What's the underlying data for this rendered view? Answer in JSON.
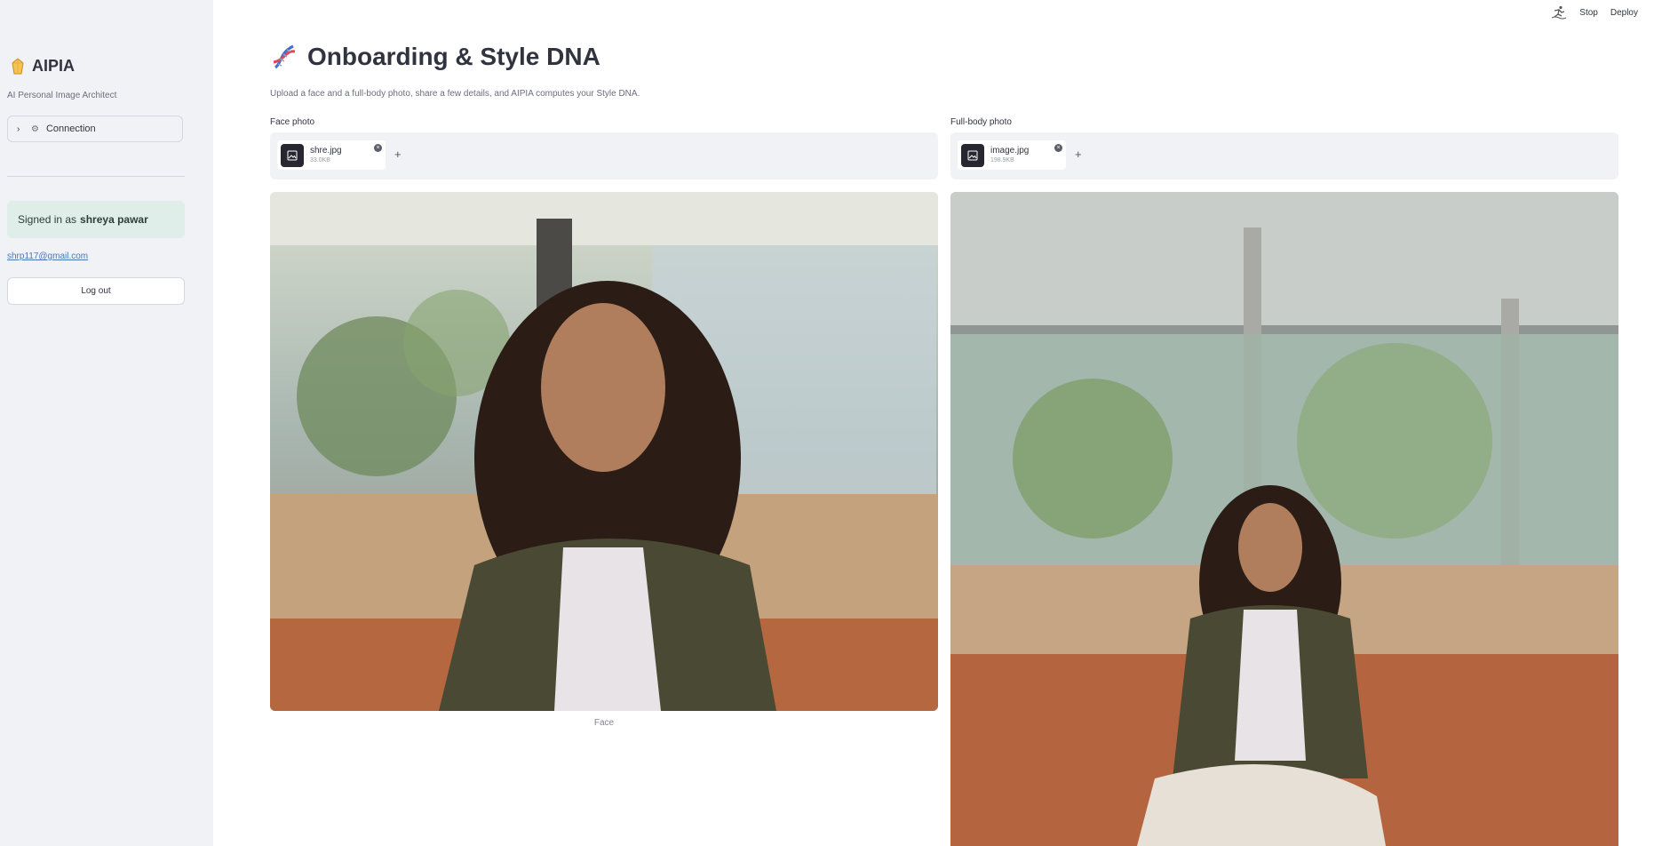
{
  "sidebar": {
    "brand_name": "AIPIA",
    "brand_sub": "AI Personal Image Architect",
    "connection_label": "Connection",
    "signed_prefix": "Signed in as",
    "signed_user": "shreya pawar",
    "email": "shrp117@gmail.com",
    "logout_label": "Log out"
  },
  "topbar": {
    "stop_label": "Stop",
    "deploy_label": "Deploy"
  },
  "main": {
    "title": "Onboarding & Style DNA",
    "subtitle": "Upload a face and a full-body photo, share a few details, and AIPIA computes your Style DNA.",
    "face": {
      "label": "Face photo",
      "file_name": "shre.jpg",
      "file_size": "33.0KB",
      "caption": "Face"
    },
    "body": {
      "label": "Full-body photo",
      "file_name": "image.jpg",
      "file_size": "198.9KB"
    }
  },
  "icons": {
    "brand": "gem-icon",
    "title": "dna-icon",
    "expander": "chevron-right-icon",
    "connection": "gear-icon",
    "run": "running-icon"
  },
  "colors": {
    "sidebar_bg": "#f0f2f6",
    "signed_bg": "#dfeee8",
    "link": "#4a77b4"
  }
}
